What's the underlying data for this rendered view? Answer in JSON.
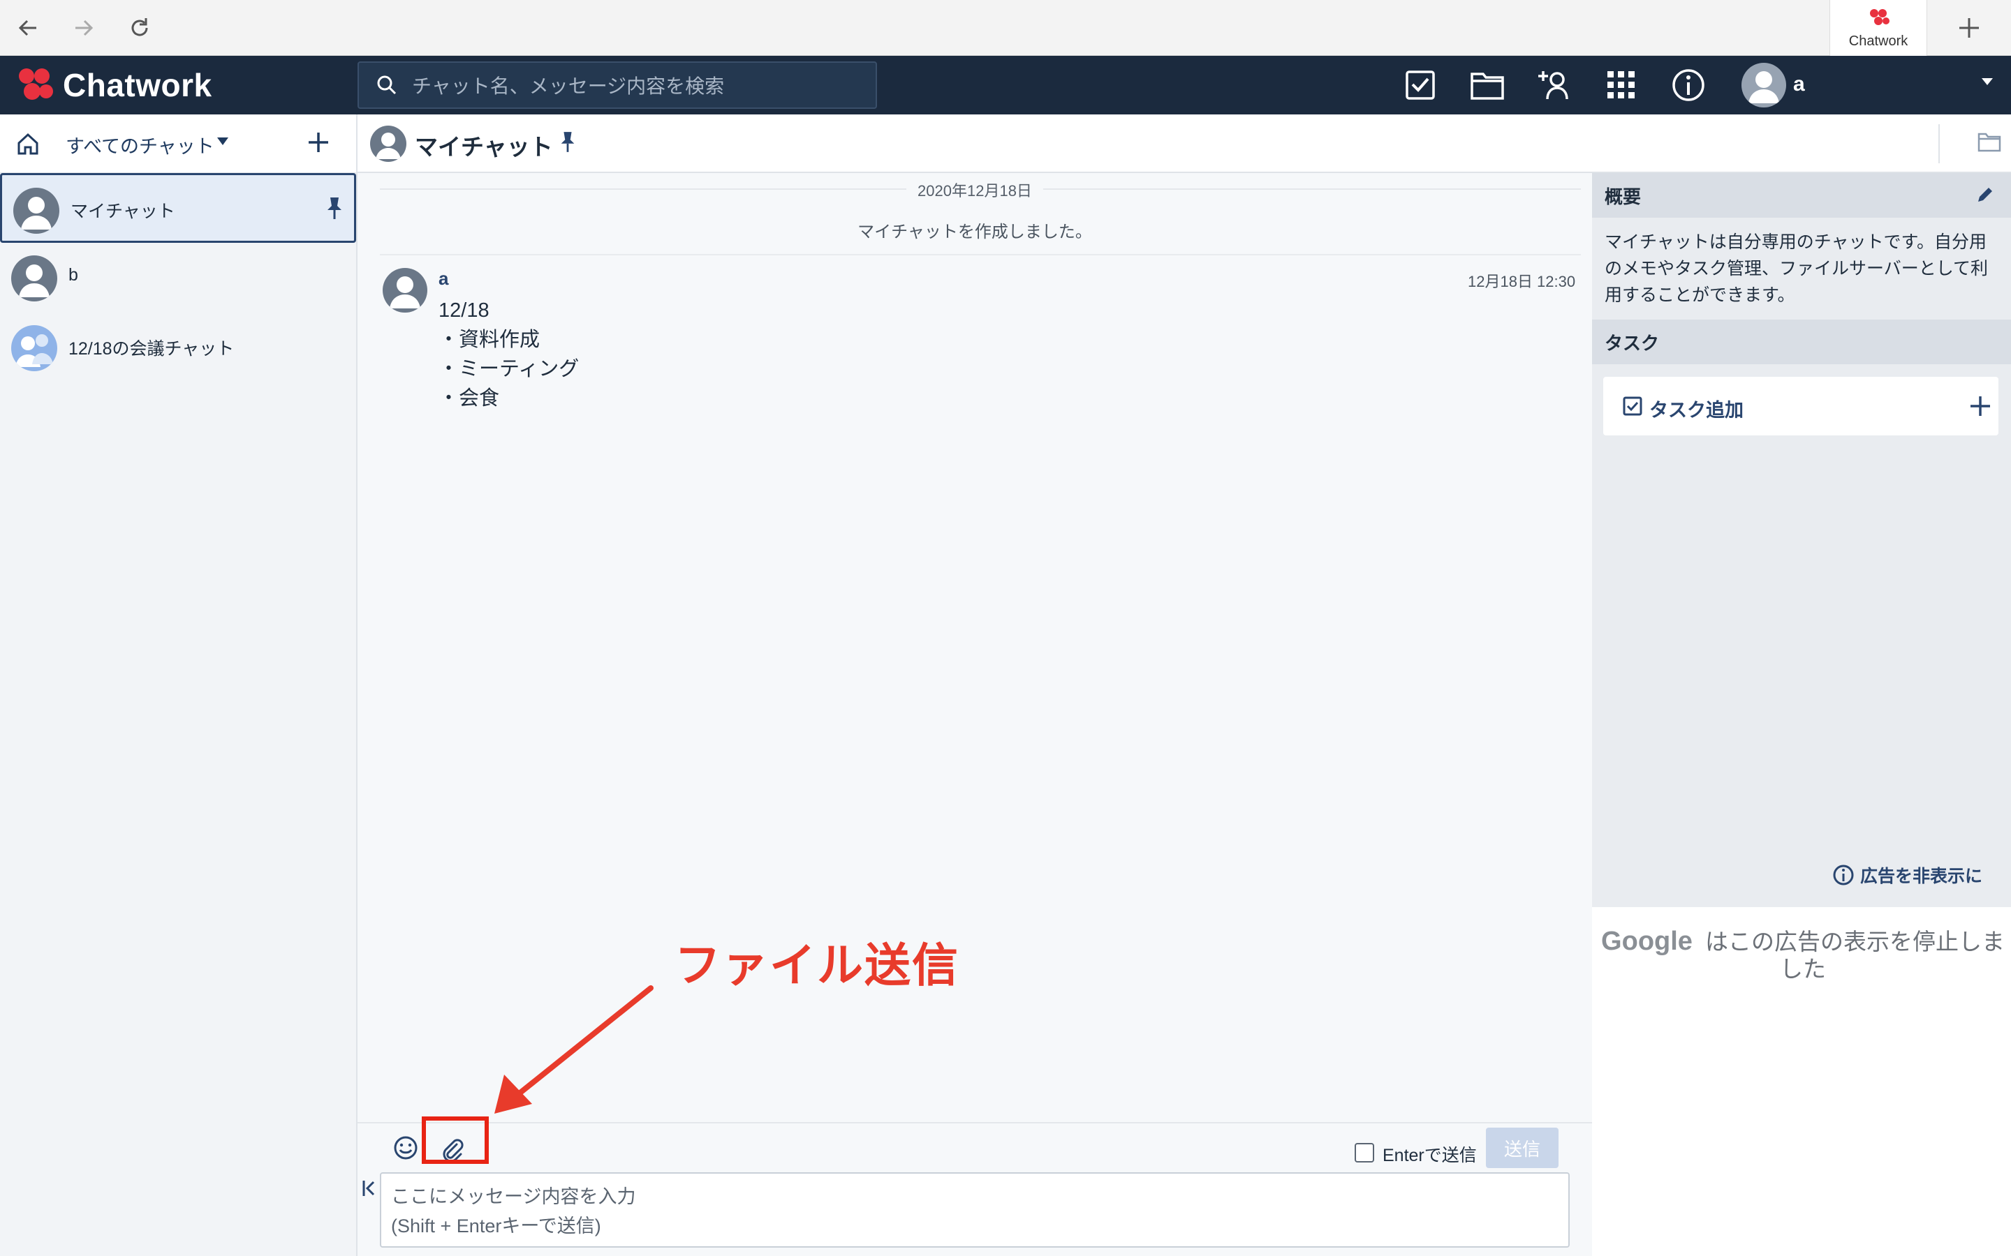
{
  "browser": {
    "tab_title": "Chatwork",
    "icons": [
      "back-arrow-icon",
      "forward-arrow-icon",
      "reload-icon",
      "new-tab-plus-icon"
    ]
  },
  "header": {
    "logo_text": "Chatwork",
    "search_placeholder": "チャット名、メッセージ内容を検索",
    "user_name": "a",
    "icons": [
      "task-icon",
      "file-folder-icon",
      "add-contact-icon",
      "apps-grid-icon",
      "info-icon"
    ]
  },
  "sidebar": {
    "filter_label": "すべてのチャット",
    "rooms": [
      {
        "name": "マイチャット",
        "active": true,
        "pinned": true
      },
      {
        "name": "b",
        "active": false,
        "pinned": false
      },
      {
        "name": "12/18の会議チャット",
        "active": false,
        "pinned": false
      }
    ]
  },
  "room": {
    "title": "マイチャット"
  },
  "timeline": {
    "date_label": "2020年12月18日",
    "system_message": "マイチャットを作成しました。",
    "message": {
      "user": "a",
      "time": "12月18日 12:30",
      "lines": [
        "12/18",
        "・資料作成",
        "・ミーティング",
        "・会食"
      ]
    }
  },
  "annotation": {
    "label": "ファイル送信",
    "color": "#e83b2b"
  },
  "composer": {
    "enter_send_label": "Enterで送信",
    "send_button": "送信",
    "placeholder_line1": "ここにメッセージ内容を入力",
    "placeholder_line2": "(Shift + Enterキーで送信)"
  },
  "right_panel": {
    "overview_title": "概要",
    "overview_text": "マイチャットは自分専用のチャットです。自分用のメモやタスク管理、ファイルサーバーとして利用することができます。",
    "task_title": "タスク",
    "add_task_label": "タスク追加",
    "hide_ad_label": "広告を非表示に",
    "google_logo_text": "Google",
    "google_message": "はこの広告の表示を停止しました"
  },
  "colors": {
    "header_bg": "#1b2a3e",
    "accent": "#29456f",
    "logo_red": "#e8313f"
  }
}
